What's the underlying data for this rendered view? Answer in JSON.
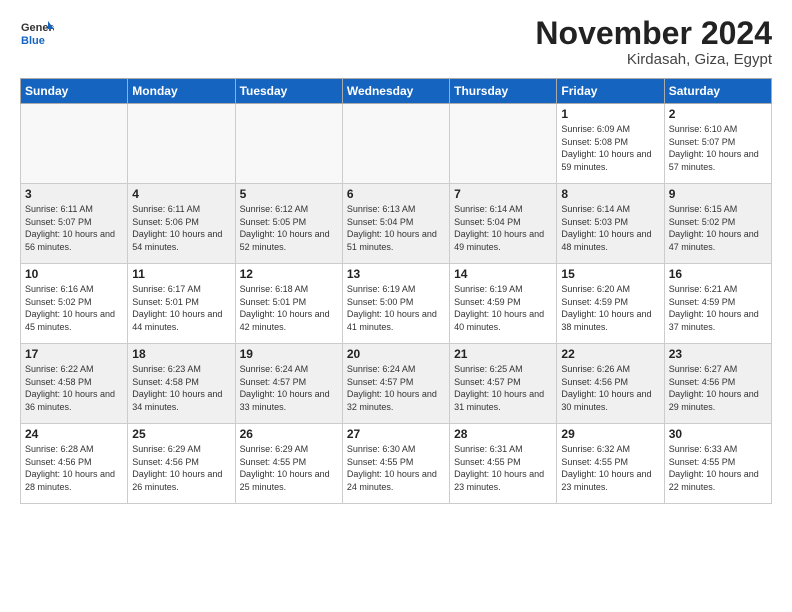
{
  "header": {
    "logo_general": "General",
    "logo_blue": "Blue",
    "month_title": "November 2024",
    "location": "Kirdasah, Giza, Egypt"
  },
  "weekdays": [
    "Sunday",
    "Monday",
    "Tuesday",
    "Wednesday",
    "Thursday",
    "Friday",
    "Saturday"
  ],
  "weeks": [
    [
      {
        "day": "",
        "info": ""
      },
      {
        "day": "",
        "info": ""
      },
      {
        "day": "",
        "info": ""
      },
      {
        "day": "",
        "info": ""
      },
      {
        "day": "",
        "info": ""
      },
      {
        "day": "1",
        "info": "Sunrise: 6:09 AM\nSunset: 5:08 PM\nDaylight: 10 hours and 59 minutes."
      },
      {
        "day": "2",
        "info": "Sunrise: 6:10 AM\nSunset: 5:07 PM\nDaylight: 10 hours and 57 minutes."
      }
    ],
    [
      {
        "day": "3",
        "info": "Sunrise: 6:11 AM\nSunset: 5:07 PM\nDaylight: 10 hours and 56 minutes."
      },
      {
        "day": "4",
        "info": "Sunrise: 6:11 AM\nSunset: 5:06 PM\nDaylight: 10 hours and 54 minutes."
      },
      {
        "day": "5",
        "info": "Sunrise: 6:12 AM\nSunset: 5:05 PM\nDaylight: 10 hours and 52 minutes."
      },
      {
        "day": "6",
        "info": "Sunrise: 6:13 AM\nSunset: 5:04 PM\nDaylight: 10 hours and 51 minutes."
      },
      {
        "day": "7",
        "info": "Sunrise: 6:14 AM\nSunset: 5:04 PM\nDaylight: 10 hours and 49 minutes."
      },
      {
        "day": "8",
        "info": "Sunrise: 6:14 AM\nSunset: 5:03 PM\nDaylight: 10 hours and 48 minutes."
      },
      {
        "day": "9",
        "info": "Sunrise: 6:15 AM\nSunset: 5:02 PM\nDaylight: 10 hours and 47 minutes."
      }
    ],
    [
      {
        "day": "10",
        "info": "Sunrise: 6:16 AM\nSunset: 5:02 PM\nDaylight: 10 hours and 45 minutes."
      },
      {
        "day": "11",
        "info": "Sunrise: 6:17 AM\nSunset: 5:01 PM\nDaylight: 10 hours and 44 minutes."
      },
      {
        "day": "12",
        "info": "Sunrise: 6:18 AM\nSunset: 5:01 PM\nDaylight: 10 hours and 42 minutes."
      },
      {
        "day": "13",
        "info": "Sunrise: 6:19 AM\nSunset: 5:00 PM\nDaylight: 10 hours and 41 minutes."
      },
      {
        "day": "14",
        "info": "Sunrise: 6:19 AM\nSunset: 4:59 PM\nDaylight: 10 hours and 40 minutes."
      },
      {
        "day": "15",
        "info": "Sunrise: 6:20 AM\nSunset: 4:59 PM\nDaylight: 10 hours and 38 minutes."
      },
      {
        "day": "16",
        "info": "Sunrise: 6:21 AM\nSunset: 4:59 PM\nDaylight: 10 hours and 37 minutes."
      }
    ],
    [
      {
        "day": "17",
        "info": "Sunrise: 6:22 AM\nSunset: 4:58 PM\nDaylight: 10 hours and 36 minutes."
      },
      {
        "day": "18",
        "info": "Sunrise: 6:23 AM\nSunset: 4:58 PM\nDaylight: 10 hours and 34 minutes."
      },
      {
        "day": "19",
        "info": "Sunrise: 6:24 AM\nSunset: 4:57 PM\nDaylight: 10 hours and 33 minutes."
      },
      {
        "day": "20",
        "info": "Sunrise: 6:24 AM\nSunset: 4:57 PM\nDaylight: 10 hours and 32 minutes."
      },
      {
        "day": "21",
        "info": "Sunrise: 6:25 AM\nSunset: 4:57 PM\nDaylight: 10 hours and 31 minutes."
      },
      {
        "day": "22",
        "info": "Sunrise: 6:26 AM\nSunset: 4:56 PM\nDaylight: 10 hours and 30 minutes."
      },
      {
        "day": "23",
        "info": "Sunrise: 6:27 AM\nSunset: 4:56 PM\nDaylight: 10 hours and 29 minutes."
      }
    ],
    [
      {
        "day": "24",
        "info": "Sunrise: 6:28 AM\nSunset: 4:56 PM\nDaylight: 10 hours and 28 minutes."
      },
      {
        "day": "25",
        "info": "Sunrise: 6:29 AM\nSunset: 4:56 PM\nDaylight: 10 hours and 26 minutes."
      },
      {
        "day": "26",
        "info": "Sunrise: 6:29 AM\nSunset: 4:55 PM\nDaylight: 10 hours and 25 minutes."
      },
      {
        "day": "27",
        "info": "Sunrise: 6:30 AM\nSunset: 4:55 PM\nDaylight: 10 hours and 24 minutes."
      },
      {
        "day": "28",
        "info": "Sunrise: 6:31 AM\nSunset: 4:55 PM\nDaylight: 10 hours and 23 minutes."
      },
      {
        "day": "29",
        "info": "Sunrise: 6:32 AM\nSunset: 4:55 PM\nDaylight: 10 hours and 23 minutes."
      },
      {
        "day": "30",
        "info": "Sunrise: 6:33 AM\nSunset: 4:55 PM\nDaylight: 10 hours and 22 minutes."
      }
    ]
  ]
}
